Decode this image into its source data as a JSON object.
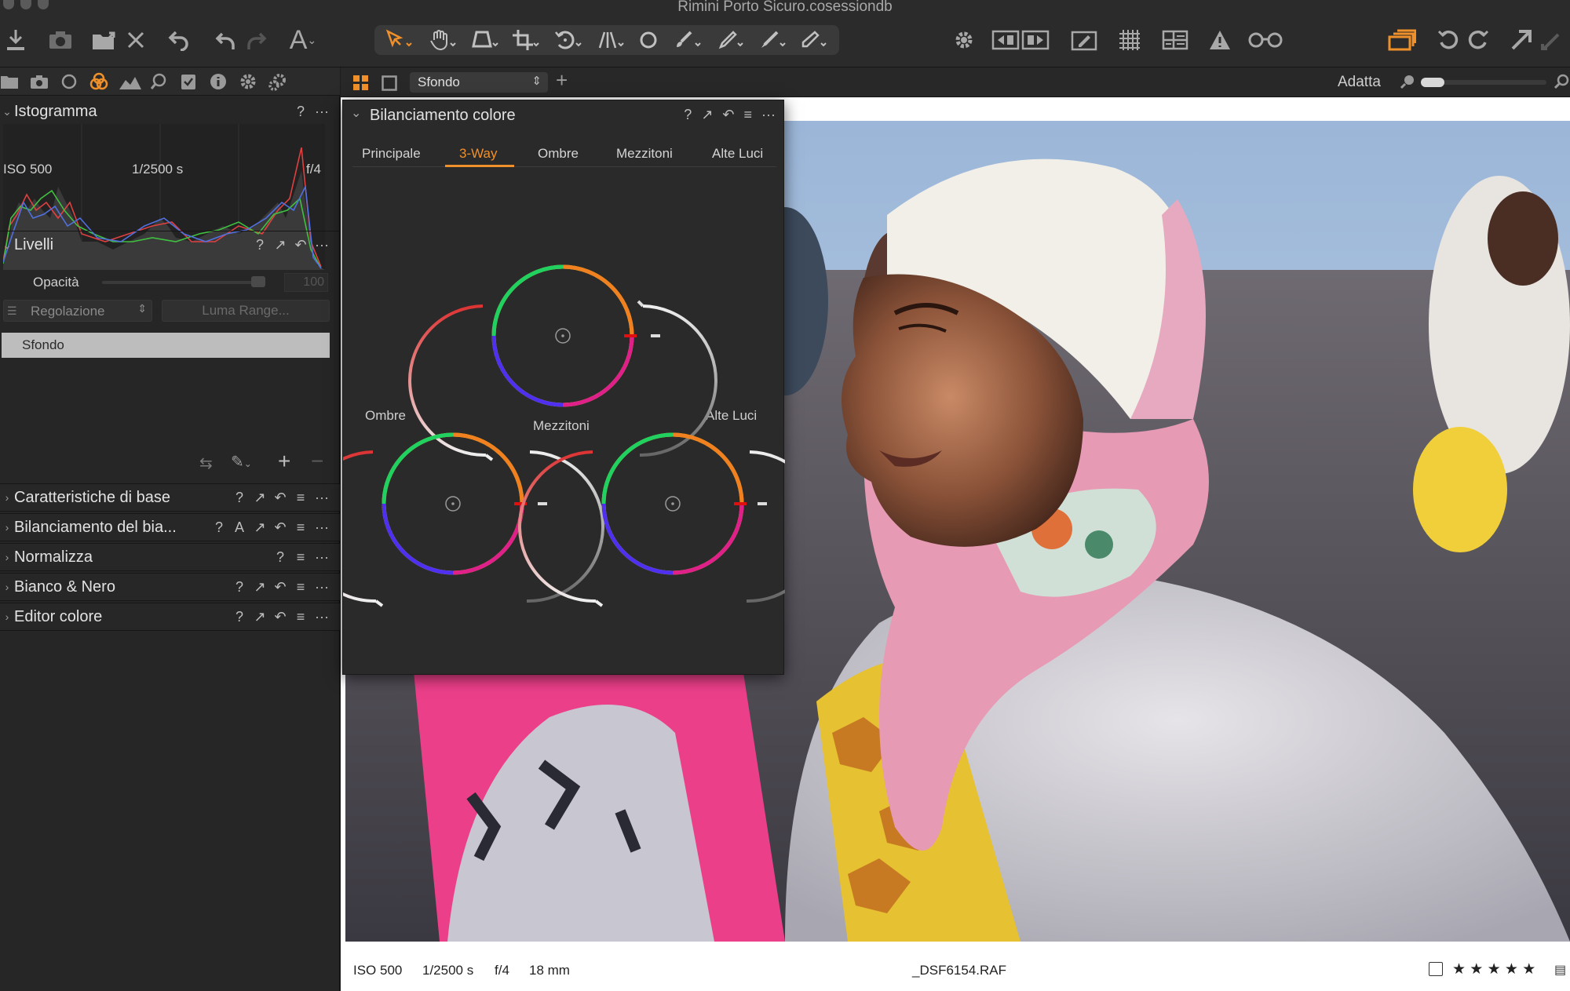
{
  "window": {
    "title": "Rimini Porto Sicuro.cosessiondb"
  },
  "toolbar": {
    "left_icons": [
      "import-icon",
      "camera-icon",
      "export-icon",
      "delete-icon",
      "undo-icon",
      "undo-step-icon",
      "redo-step-icon",
      "text-icon"
    ],
    "cursor_tools": [
      "select-cursor-icon",
      "pan-hand-icon",
      "keystone-icon",
      "crop-icon",
      "rotate-icon",
      "straighten-icon",
      "circle-icon",
      "brush-icon",
      "eyedropper-icon",
      "picker-icon",
      "eraser-icon"
    ],
    "right_icons": [
      "settings-gear-icon",
      "compare-icon",
      "edit-icon",
      "grid-icon",
      "layout-icon",
      "warning-icon",
      "glasses-icon",
      "stack-icon",
      "rotate-left-icon",
      "rotate-right-icon",
      "expand-icon"
    ]
  },
  "tool_tabs": [
    "folder-icon",
    "camera-icon",
    "lens-icon",
    "color-icon",
    "exposure-icon",
    "details-icon",
    "metadata-icon",
    "info-icon",
    "settings-icon",
    "batch-icon"
  ],
  "histogram": {
    "title": "Istogramma",
    "iso": "ISO 500",
    "shutter": "1/2500 s",
    "aperture": "f/4"
  },
  "layers": {
    "title": "Livelli",
    "opacity_label": "Opacità",
    "opacity_value": "100",
    "opacity_level": 1.0,
    "adjust_select": "Regolazione",
    "luma_button": "Luma Range...",
    "layer_name": "Sfondo"
  },
  "collapsed_sections": [
    {
      "title": "Caratteristiche di base",
      "icons": [
        "?",
        "↗",
        "↶",
        "≡",
        "···"
      ]
    },
    {
      "title": "Bilanciamento del bia...",
      "icons": [
        "?",
        "A",
        "↗",
        "↶",
        "≡",
        "···"
      ]
    },
    {
      "title": "Normalizza",
      "icons": [
        "?",
        "≡",
        "···"
      ]
    },
    {
      "title": "Bianco & Nero",
      "icons": [
        "?",
        "↗",
        "↶",
        "≡",
        "···"
      ]
    },
    {
      "title": "Editor colore",
      "icons": [
        "?",
        "↗",
        "↶",
        "≡",
        "···"
      ]
    }
  ],
  "color_balance": {
    "title": "Bilanciamento colore",
    "tabs": [
      "Principale",
      "3-Way",
      "Ombre",
      "Mezzitoni",
      "Alte Luci"
    ],
    "active_tab": "3-Way",
    "wheel_labels": {
      "shadows": "Ombre",
      "midtones": "Mezzitoni",
      "highlights": "Alte Luci"
    }
  },
  "viewer": {
    "layer_select": "Sfondo",
    "zoom_label": "Adatta"
  },
  "photo_info": {
    "iso": "ISO 500",
    "shutter": "1/2500 s",
    "aperture": "f/4",
    "focal": "18 mm",
    "filename": "_DSF6154.RAF",
    "rating_stars": "★ ★ ★ ★ ★"
  },
  "colors": {
    "accent": "#f0902a",
    "panel": "#262626",
    "toolbar": "#2b2b2b"
  }
}
